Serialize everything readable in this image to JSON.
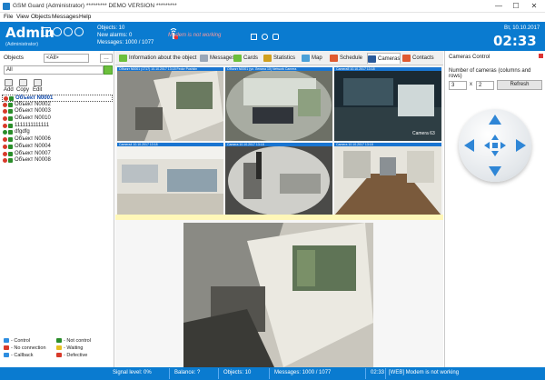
{
  "window": {
    "title": "GSM Guard (Administrator) ********* DEMO VERSION *********",
    "controls": [
      "—",
      "☐",
      "✕"
    ]
  },
  "menu": [
    "File",
    "View",
    "Objects",
    "Messages",
    "Help"
  ],
  "header": {
    "user": "Admin",
    "role": "(Administrator)",
    "objects": "Objects:  10",
    "new_alarms": "New alarms:  0",
    "messages": "Messages:  1000 / 1077",
    "modem_status": "Modem is not working",
    "date": "Вт, 10.10.2017",
    "clock": "02:33"
  },
  "left_panel": {
    "objects_label": "Objects",
    "filter_value": "<All>",
    "search_value": "All",
    "toolbar": {
      "add": "Add",
      "copy": "Copy",
      "edit": "Edit"
    },
    "objects": [
      {
        "name": "Объект N0001",
        "selected": true,
        "status_color": "#d83a2a"
      },
      {
        "name": "Объект N0002",
        "selected": false,
        "status_color": "#d83a2a"
      },
      {
        "name": "Объект N0003",
        "selected": false,
        "status_color": "#d83a2a"
      },
      {
        "name": "Объект N0010",
        "selected": false,
        "status_color": "#d83a2a"
      },
      {
        "name": "1111111111111",
        "selected": false,
        "status_color": "#d83a2a"
      },
      {
        "name": "dfgdfg",
        "selected": false,
        "status_color": "#2a8d2a"
      },
      {
        "name": "Объект N0006",
        "selected": false,
        "status_color": "#d83a2a"
      },
      {
        "name": "Объект N0004",
        "selected": false,
        "status_color": "#d83a2a"
      },
      {
        "name": "Объект N0007",
        "selected": false,
        "status_color": "#d83a2a"
      },
      {
        "name": "Объект N0008",
        "selected": false,
        "status_color": "#d83a2a"
      }
    ],
    "legend": [
      {
        "label": "- Control",
        "color": "#2e8ee0"
      },
      {
        "label": "- Not control",
        "color": "#2a8d2a"
      },
      {
        "label": "- No connection",
        "color": "#d83a2a"
      },
      {
        "label": "- Waiting",
        "color": "#e6c020"
      },
      {
        "label": "- Callback",
        "color": "#2e8ee0"
      },
      {
        "label": "- Defective",
        "color": "#d83a2a"
      }
    ]
  },
  "tabs": [
    {
      "label": "Information about the object",
      "active": false,
      "icon_color": "#6cbf3c"
    },
    {
      "label": "Messages",
      "active": false,
      "icon_color": "#9aa7b8"
    },
    {
      "label": "Cards",
      "active": false,
      "icon_color": "#6cbf3c"
    },
    {
      "label": "Statistics",
      "active": false,
      "icon_color": "#d0a020"
    },
    {
      "label": "Map",
      "active": false,
      "icon_color": "#4aa0d8"
    },
    {
      "label": "Schedule",
      "active": false,
      "icon_color": "#e05a30"
    },
    {
      "label": "Cameras",
      "active": true,
      "icon_color": "#2a5a9a"
    },
    {
      "label": "Contacts",
      "active": false,
      "icon_color": "#e05a30"
    }
  ],
  "cameras": [
    {
      "label": "Объект N0001 (1717) 10.10.2017 13:18 Fedor Pushkin"
    },
    {
      "label": "Объект N0001 (ул. Ленина 10) Network Camera"
    },
    {
      "label": "Camera5  10.10.2017 13:18"
    },
    {
      "label": "Camera4  10.10.2017 13:18"
    },
    {
      "label": "Camera  10.10.2017 13:18"
    },
    {
      "label": "Camera  10.10.2017 13:18"
    }
  ],
  "camera_overlay": "Camera 63",
  "right_panel": {
    "title": "Cameras Control",
    "num_cameras_label": "Number of cameras (columns and rows)",
    "cols": "3",
    "x": "x",
    "rows": "2",
    "refresh": "Refresh"
  },
  "status": {
    "signal": "Signal level:  0%",
    "balance": "Balance:  ?",
    "objects": "Objects:  10",
    "messages": "Messages:  1000 / 1077",
    "time": "02:33",
    "modem": "[WEB] Modem is not working"
  }
}
